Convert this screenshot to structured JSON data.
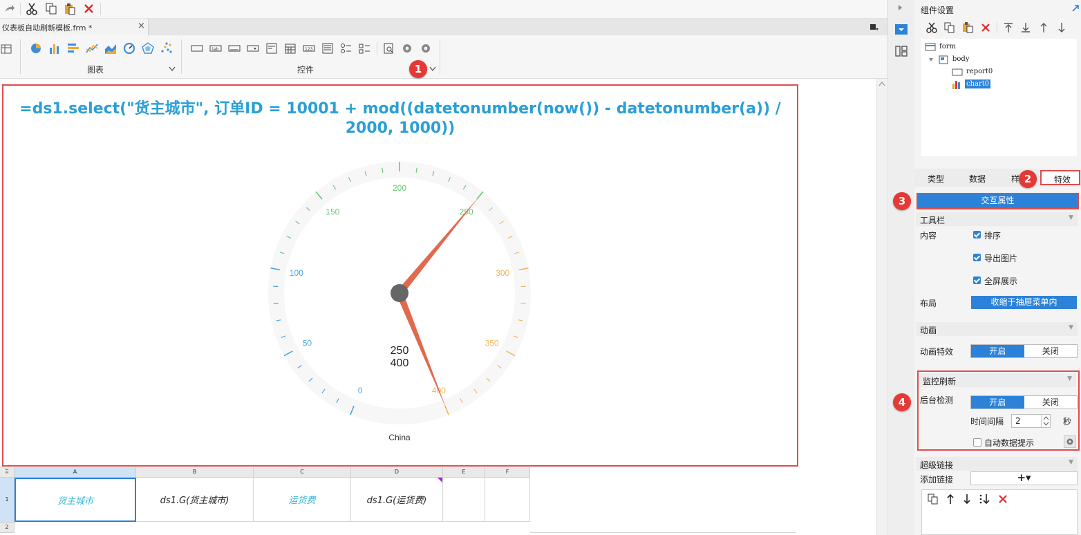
{
  "document_tab": {
    "title": "仪表板自动刷新模板.frm *",
    "close": "×"
  },
  "ribbon": {
    "chart_group_label": "图表",
    "widget_group_label": "控件"
  },
  "chart": {
    "title": "=ds1.select(\"货主城市\", 订单ID = 10001 + mod((datetonumber(now()) - datetonumber(a)) / 2000, 1000))",
    "value_line1": "250",
    "value_line2": "400",
    "category": "China"
  },
  "chart_data": {
    "type": "gauge",
    "min": 0,
    "max": 400,
    "tick_labels": [
      "0",
      "50",
      "100",
      "150",
      "200",
      "250",
      "300",
      "350",
      "400"
    ],
    "pointers": [
      250,
      400
    ],
    "band_colors": [
      "#4aa6e0",
      "#6cc77a",
      "#f2b45c"
    ],
    "pointer_color": "#e06a4e"
  },
  "sheet": {
    "columns": [
      "A",
      "B",
      "C",
      "D",
      "E",
      "F"
    ],
    "rows": [
      "1",
      "2"
    ],
    "cells": [
      "货主城市",
      "ds1.G(货主城市)",
      "运货费",
      "ds1.G(运货费)"
    ]
  },
  "right_panel": {
    "title": "组件设置",
    "tree": {
      "form": "form",
      "body": "body",
      "report": "report0",
      "chart": "chart0"
    },
    "tabs": [
      "类型",
      "数据",
      "样",
      "特效"
    ],
    "interaction_button": "交互属性",
    "toolbar_section": "工具栏",
    "content_label": "内容",
    "check_sort": "排序",
    "check_export": "导出图片",
    "check_fullscreen": "全屏展示",
    "layout_label": "布局",
    "layout_value": "收缩于抽屉菜单内",
    "animation_section": "动画",
    "animation_label": "动画特效",
    "on": "开启",
    "off": "关闭",
    "monitor_section": "监控刷新",
    "bg_check_label": "后台检测",
    "interval_label": "时间间隔",
    "interval_value": "2",
    "seconds": "秒",
    "auto_tip": "自动数据提示",
    "hyperlink_section": "超级链接",
    "add_link_label": "添加链接",
    "add_symbol": "+▾"
  },
  "badges": [
    "1",
    "2",
    "3",
    "4"
  ],
  "colors": {
    "accent_blue": "#2c82d8",
    "title_blue": "#2a9fd6",
    "highlight_red": "#e14b4b",
    "badge_red": "#e53935"
  }
}
